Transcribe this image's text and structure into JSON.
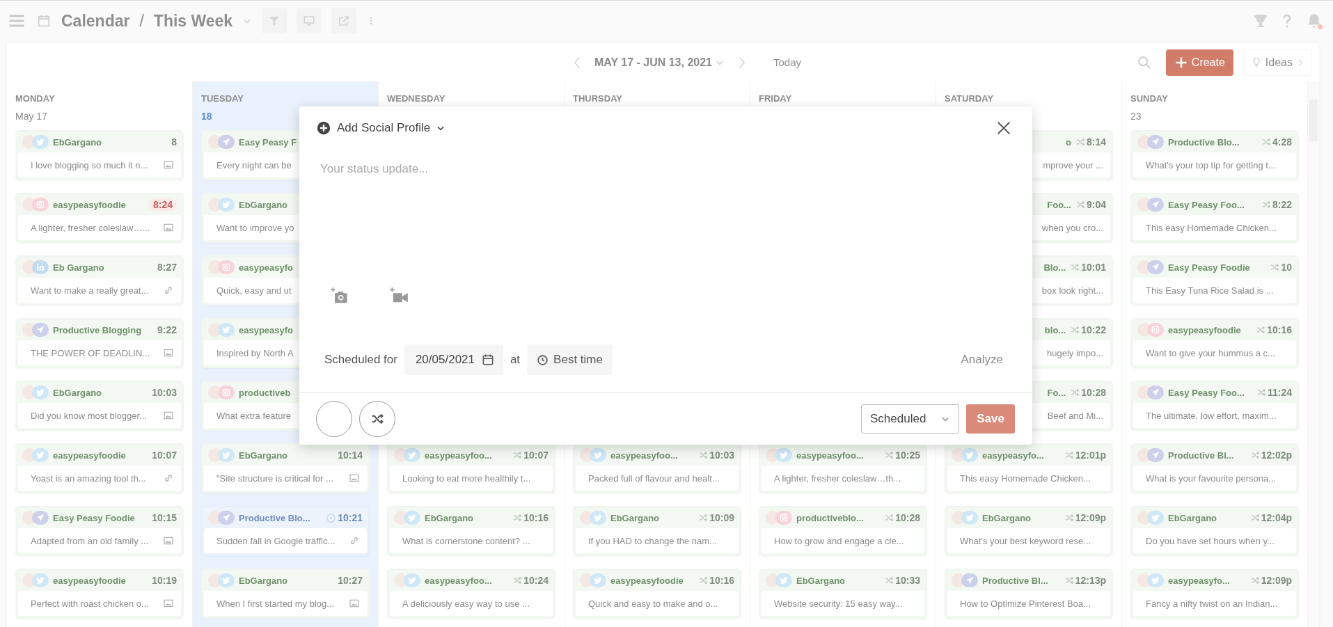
{
  "topbar": {
    "section": "Calendar",
    "separator": "/",
    "view": "This Week"
  },
  "toolbar": {
    "range": "MAY 17 - JUN 13, 2021",
    "today": "Today",
    "create": "Create",
    "ideas": "Ideas"
  },
  "columns": [
    {
      "day": "MONDAY",
      "date": "May 17",
      "today": false,
      "cards": [
        {
          "kind": "post",
          "network": {
            "kind": "twitter"
          },
          "name": "EbGargano",
          "time": "8",
          "text": "I love blogging so much it n...",
          "attachment": {
            "kind": "image"
          }
        },
        {
          "kind": "failed",
          "network": {
            "kind": "instagram"
          },
          "name": "easypeasyfoodie",
          "time": "8:24",
          "text": "A lighter, fresher coleslaw…...",
          "attachment": {
            "kind": "image"
          }
        },
        {
          "kind": "post",
          "network": {
            "kind": "linkedin"
          },
          "name": "Eb Gargano",
          "time": "8:27",
          "text": "Want to make a really great...",
          "attachment": {
            "kind": "link"
          }
        },
        {
          "kind": "post",
          "network": {
            "kind": "send"
          },
          "name": "Productive Blogging",
          "time": "9:22",
          "text": "THE POWER OF DEADLIN...",
          "attachment": {
            "kind": "image"
          }
        },
        {
          "kind": "post",
          "network": {
            "kind": "twitter"
          },
          "name": "EbGargano",
          "time": "10:03",
          "text": "Did you know most blogger...",
          "attachment": {
            "kind": "image"
          }
        },
        {
          "kind": "post",
          "network": {
            "kind": "twitter"
          },
          "name": "easypeasyfoodie",
          "time": "10:07",
          "text": "Yoast is an amazing tool th...",
          "attachment": {
            "kind": "link"
          }
        },
        {
          "kind": "post",
          "network": {
            "kind": "send"
          },
          "name": "Easy Peasy Foodie",
          "time": "10:15",
          "text": "Adapted from an old family ...",
          "attachment": {
            "kind": "image"
          }
        },
        {
          "kind": "post",
          "network": {
            "kind": "twitter"
          },
          "name": "easypeasyfoodie",
          "time": "10:19",
          "text": "Perfect with roast chicken o...",
          "attachment": {
            "kind": "image"
          }
        }
      ]
    },
    {
      "day": "TUESDAY",
      "date": "18",
      "today": true,
      "cards": [
        {
          "kind": "post",
          "network": {
            "kind": "send"
          },
          "name": "Easy Peasy F",
          "text": "Every night can be"
        },
        {
          "kind": "post",
          "network": {
            "kind": "twitter"
          },
          "name": "EbGargano",
          "text": "Want to improve yo"
        },
        {
          "kind": "post",
          "network": {
            "kind": "instagram"
          },
          "name": "easypeasyfo",
          "text": "Quick, easy and ut"
        },
        {
          "kind": "post",
          "network": {
            "kind": "twitter"
          },
          "name": "easypeasyfo",
          "text": "Inspired by North A"
        },
        {
          "kind": "post",
          "network": {
            "kind": "instagram"
          },
          "name": "productiveb",
          "text": "What extra feature"
        },
        {
          "kind": "post",
          "network": {
            "kind": "twitter"
          },
          "name": "EbGargano",
          "time": "10:14",
          "text": "\"Site structure is critical for ...",
          "attachment": {
            "kind": "image"
          }
        },
        {
          "kind": "editing",
          "network": {
            "kind": "send"
          },
          "name": "Productive Blo...",
          "time_icon": {
            "kind": "clock"
          },
          "time": "10:21",
          "text": "Sudden fall in Google traffic...",
          "attachment": {
            "kind": "link"
          }
        },
        {
          "kind": "post",
          "network": {
            "kind": "twitter"
          },
          "name": "EbGargano",
          "time": "10:27",
          "text": "When I first started my blog...",
          "attachment": {
            "kind": "image"
          }
        }
      ]
    },
    {
      "day": "WEDNESDAY",
      "today": false,
      "cards": [
        {
          "kind": "post",
          "network": {
            "kind": "twitter"
          },
          "name": "easypeasyfoo...",
          "time_icon": {
            "kind": "shuffle"
          },
          "time": "10:07",
          "text": "Looking to eat more healthily t..."
        },
        {
          "kind": "post",
          "network": {
            "kind": "twitter"
          },
          "name": "EbGargano",
          "time_icon": {
            "kind": "shuffle"
          },
          "time": "10:16",
          "text": "What is cornerstone content? ..."
        },
        {
          "kind": "post",
          "network": {
            "kind": "twitter"
          },
          "name": "easypeasyfoo...",
          "time_icon": {
            "kind": "shuffle"
          },
          "time": "10:24",
          "text": "A deliciously easy way to use ..."
        }
      ]
    },
    {
      "day": "THURSDAY",
      "today": false,
      "cards": [
        {
          "kind": "post",
          "network": {
            "kind": "twitter"
          },
          "name": "easypeasyfoo...",
          "time_icon": {
            "kind": "shuffle"
          },
          "time": "10:03",
          "text": "Packed full of flavour and healt..."
        },
        {
          "kind": "post",
          "network": {
            "kind": "twitter"
          },
          "name": "EbGargano",
          "time_icon": {
            "kind": "shuffle"
          },
          "time": "10:09",
          "text": "If you HAD to change the nam..."
        },
        {
          "kind": "post",
          "network": {
            "kind": "twitter"
          },
          "name": "easypeasyfoodie",
          "time_icon": {
            "kind": "shuffle"
          },
          "time": "10:16",
          "text": "Quick and easy to make and o..."
        }
      ]
    },
    {
      "day": "FRIDAY",
      "today": false,
      "cards": [
        {
          "kind": "post",
          "network": {
            "kind": "twitter"
          },
          "name": "easypeasyfoo...",
          "time_icon": {
            "kind": "shuffle"
          },
          "time": "10:25",
          "text": "A lighter, fresher coleslaw…th..."
        },
        {
          "kind": "post",
          "network": {
            "kind": "instagram"
          },
          "name": "productiveblo...",
          "time_icon": {
            "kind": "shuffle"
          },
          "time": "10:28",
          "text": "How to grow and engage a cle..."
        },
        {
          "kind": "post",
          "network": {
            "kind": "twitter"
          },
          "name": "EbGargano",
          "time_icon": {
            "kind": "shuffle"
          },
          "time": "10:33",
          "text": "Website security: 15 easy way..."
        }
      ]
    },
    {
      "day": "SATURDAY",
      "today": false,
      "cards": [
        {
          "kind": "post",
          "name": "o",
          "time_icon": {
            "kind": "shuffle"
          },
          "time": "8:14",
          "text": "mprove your ..."
        },
        {
          "kind": "post",
          "name": "Foo...",
          "time_icon": {
            "kind": "shuffle"
          },
          "time": "9:04",
          "text": "when you cro..."
        },
        {
          "kind": "post",
          "name": "Blo...",
          "time_icon": {
            "kind": "shuffle"
          },
          "time": "10:01",
          "text": "box look right..."
        },
        {
          "kind": "post",
          "name": "blo...",
          "time_icon": {
            "kind": "shuffle"
          },
          "time": "10:22",
          "text": "hugely impo..."
        },
        {
          "kind": "post",
          "name": "Fo...",
          "time_icon": {
            "kind": "shuffle"
          },
          "time": "10:28",
          "text": "Beef and Mi..."
        },
        {
          "kind": "post",
          "network": {
            "kind": "twitter"
          },
          "name": "easypeasyfo...",
          "time_icon": {
            "kind": "shuffle"
          },
          "time": "12:01p",
          "text": "This easy Homemade Chicken..."
        },
        {
          "kind": "post",
          "network": {
            "kind": "twitter"
          },
          "name": "EbGargano",
          "time_icon": {
            "kind": "shuffle"
          },
          "time": "12:09p",
          "text": "What's your best keyword rese..."
        },
        {
          "kind": "post",
          "network": {
            "kind": "send"
          },
          "name": "Productive Bl...",
          "time_icon": {
            "kind": "shuffle"
          },
          "time": "12:13p",
          "text": "How to Optimize Pinterest Boa..."
        }
      ]
    },
    {
      "day": "SUNDAY",
      "date": "23",
      "today": false,
      "cards": [
        {
          "kind": "post",
          "network": {
            "kind": "send"
          },
          "name": "Productive Blo...",
          "time_icon": {
            "kind": "shuffle"
          },
          "time": "4:28",
          "text": "What's your top tip for getting t..."
        },
        {
          "kind": "post",
          "network": {
            "kind": "send"
          },
          "name": "Easy Peasy Foo...",
          "time_icon": {
            "kind": "shuffle"
          },
          "time": "8:22",
          "text": "This easy Homemade Chicken..."
        },
        {
          "kind": "post",
          "network": {
            "kind": "send"
          },
          "name": "Easy Peasy Foodie",
          "time_icon": {
            "kind": "shuffle"
          },
          "time": "10",
          "text": "This Easy Tuna Rice Salad is ..."
        },
        {
          "kind": "post",
          "network": {
            "kind": "instagram"
          },
          "name": "easypeasyfoodie",
          "time_icon": {
            "kind": "shuffle"
          },
          "time": "10:16",
          "text": "Want to give your hummus a c..."
        },
        {
          "kind": "post",
          "network": {
            "kind": "send"
          },
          "name": "Easy Peasy Foo...",
          "time_icon": {
            "kind": "shuffle"
          },
          "time": "11:24",
          "text": "The ultimate, low effort, maxim..."
        },
        {
          "kind": "post",
          "network": {
            "kind": "send"
          },
          "name": "Productive Bl...",
          "time_icon": {
            "kind": "shuffle"
          },
          "time": "12:02p",
          "text": "What is your favourite persona..."
        },
        {
          "kind": "post",
          "network": {
            "kind": "twitter"
          },
          "name": "EbGargano",
          "time_icon": {
            "kind": "shuffle"
          },
          "time": "12:04p",
          "text": "Do you have set hours when y..."
        },
        {
          "kind": "post",
          "network": {
            "kind": "twitter"
          },
          "name": "easypeasyfo...",
          "time_icon": {
            "kind": "shuffle"
          },
          "time": "12:09p",
          "text": "Fancy a nifty twist on an Indian..."
        }
      ]
    }
  ],
  "modal": {
    "profile_button": "Add Social Profile",
    "placeholder": "Your status update...",
    "scheduled_label": "Scheduled for",
    "date": "20/05/2021",
    "at": "at",
    "time_button": "Best time",
    "analyze": "Analyze",
    "status": "Scheduled",
    "save": "Save"
  }
}
